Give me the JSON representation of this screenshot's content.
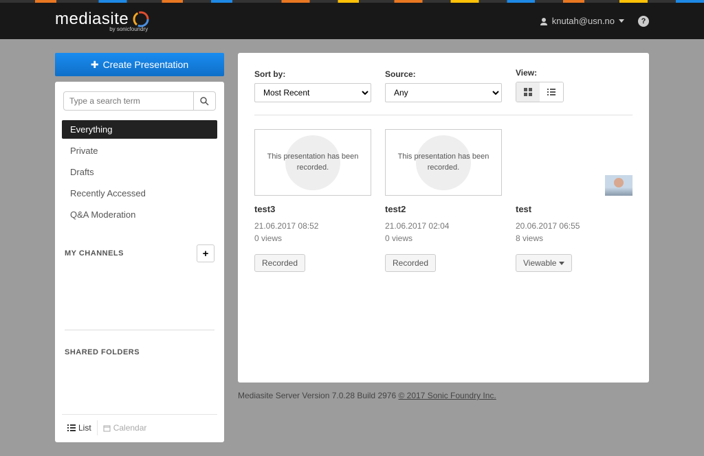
{
  "brand": {
    "name": "mediasite",
    "tagline": "by sonicfoundry"
  },
  "header": {
    "user_email": "knutah@usn.no"
  },
  "create_button": "Create Presentation",
  "search": {
    "placeholder": "Type a search term"
  },
  "nav": {
    "items": [
      {
        "label": "Everything",
        "active": true
      },
      {
        "label": "Private",
        "active": false
      },
      {
        "label": "Drafts",
        "active": false
      },
      {
        "label": "Recently Accessed",
        "active": false
      },
      {
        "label": "Q&A Moderation",
        "active": false
      }
    ]
  },
  "sections": {
    "my_channels": "MY CHANNELS",
    "shared_folders": "SHARED FOLDERS"
  },
  "sidebar_tabs": {
    "list": "List",
    "calendar": "Calendar"
  },
  "controls": {
    "sort_label": "Sort by:",
    "sort_value": "Most Recent",
    "source_label": "Source:",
    "source_value": "Any",
    "view_label": "View:"
  },
  "thumb_messages": {
    "recorded": "This presentation has been recorded."
  },
  "presentations": [
    {
      "title": "test3",
      "date": "21.06.2017 08:52",
      "views": "0 views",
      "status": "Recorded",
      "thumb": "recorded"
    },
    {
      "title": "test2",
      "date": "21.06.2017 02:04",
      "views": "0 views",
      "status": "Recorded",
      "thumb": "recorded"
    },
    {
      "title": "test",
      "date": "20.06.2017 06:55",
      "views": "8 views",
      "status": "Viewable",
      "status_dropdown": true,
      "thumb": "avatar"
    }
  ],
  "footer": {
    "version_text": "Mediasite Server Version 7.0.28 Build 2976 ",
    "copyright": "© 2017 Sonic Foundry Inc."
  }
}
